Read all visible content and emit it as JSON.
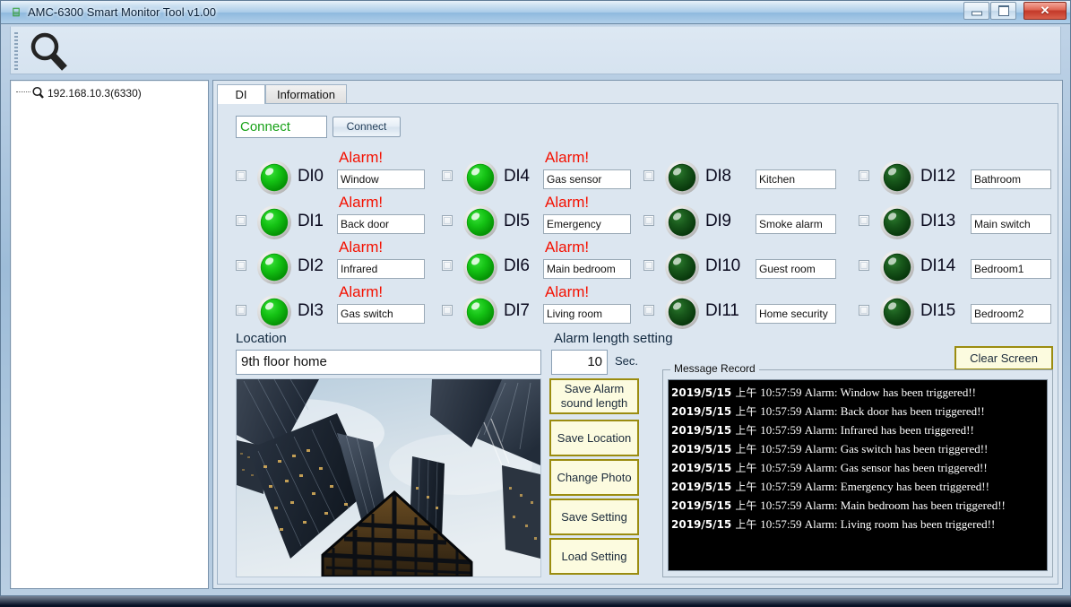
{
  "window": {
    "title": "AMC-6300 Smart Monitor Tool v1.00",
    "icon": "app-icon",
    "controls": {
      "minimize": "minimize-icon",
      "maximize": "maximize-icon",
      "close": "✕"
    }
  },
  "toolbar": {
    "search_icon": "magnifier-icon"
  },
  "tree": {
    "items": [
      {
        "label": "192.168.10.3(6330)",
        "icon": "magnifier-icon"
      }
    ]
  },
  "tabs": [
    {
      "label": "DI",
      "active": true
    },
    {
      "label": "Information",
      "active": false
    }
  ],
  "connect": {
    "status_value": "Connect",
    "status_color": "#17a117",
    "button_label": "Connect"
  },
  "di_channels": [
    {
      "id": "DI0",
      "name": "Window",
      "alarm": "Alarm!",
      "state": "on"
    },
    {
      "id": "DI1",
      "name": "Back door",
      "alarm": "Alarm!",
      "state": "on"
    },
    {
      "id": "DI2",
      "name": "Infrared",
      "alarm": "Alarm!",
      "state": "on"
    },
    {
      "id": "DI3",
      "name": "Gas switch",
      "alarm": "Alarm!",
      "state": "on"
    },
    {
      "id": "DI4",
      "name": "Gas sensor",
      "alarm": "Alarm!",
      "state": "on"
    },
    {
      "id": "DI5",
      "name": "Emergency",
      "alarm": "Alarm!",
      "state": "on"
    },
    {
      "id": "DI6",
      "name": "Main bedroom",
      "alarm": "Alarm!",
      "state": "on"
    },
    {
      "id": "DI7",
      "name": "Living room",
      "alarm": "Alarm!",
      "state": "on"
    },
    {
      "id": "DI8",
      "name": "Kitchen",
      "alarm": "",
      "state": "off"
    },
    {
      "id": "DI9",
      "name": "Smoke alarm",
      "alarm": "",
      "state": "off"
    },
    {
      "id": "DI10",
      "name": "Guest room",
      "alarm": "",
      "state": "off"
    },
    {
      "id": "DI11",
      "name": "Home security",
      "alarm": "",
      "state": "off"
    },
    {
      "id": "DI12",
      "name": "Bathroom",
      "alarm": "",
      "state": "off"
    },
    {
      "id": "DI13",
      "name": "Main switch",
      "alarm": "",
      "state": "off"
    },
    {
      "id": "DI14",
      "name": "Bedroom1",
      "alarm": "",
      "state": "off"
    },
    {
      "id": "DI15",
      "name": "Bedroom2",
      "alarm": "",
      "state": "off"
    }
  ],
  "location": {
    "title": "Location",
    "value": "9th floor home"
  },
  "alarm_length": {
    "title": "Alarm length setting",
    "value": "10",
    "unit": "Sec."
  },
  "photo": {
    "alt": "skyscrapers-photo"
  },
  "buttons": {
    "save_alarm_sound_length": "Save Alarm sound length",
    "save_location": "Save Location",
    "change_photo": "Change Photo",
    "save_setting": "Save Setting",
    "load_setting": "Load Setting",
    "clear_screen": "Clear Screen"
  },
  "message_record": {
    "legend": "Message Record",
    "lines": [
      {
        "date": "2019/5/15",
        "ampm": "上午",
        "rest": "10:57:59 Alarm: Window has been triggered!!"
      },
      {
        "date": "2019/5/15",
        "ampm": "上午",
        "rest": "10:57:59 Alarm: Back door has been triggered!!"
      },
      {
        "date": "2019/5/15",
        "ampm": "上午",
        "rest": "10:57:59 Alarm: Infrared  has been triggered!!"
      },
      {
        "date": "2019/5/15",
        "ampm": "上午",
        "rest": "10:57:59 Alarm: Gas switch has been triggered!!"
      },
      {
        "date": "2019/5/15",
        "ampm": "上午",
        "rest": "10:57:59 Alarm: Gas sensor has been triggered!!"
      },
      {
        "date": "2019/5/15",
        "ampm": "上午",
        "rest": "10:57:59 Alarm: Emergency has been triggered!!"
      },
      {
        "date": "2019/5/15",
        "ampm": "上午",
        "rest": "10:57:59 Alarm: Main bedroom has been triggered!!"
      },
      {
        "date": "2019/5/15",
        "ampm": "上午",
        "rest": "10:57:59 Alarm: Living room has been triggered!!"
      }
    ]
  },
  "colors": {
    "led_on": "#11b711",
    "led_off": "#0f4d12",
    "alarm_red": "#f41000",
    "button_yellow": "#fcfbdf",
    "button_border": "#9b8c10",
    "panel_bg": "#dce6f0"
  }
}
